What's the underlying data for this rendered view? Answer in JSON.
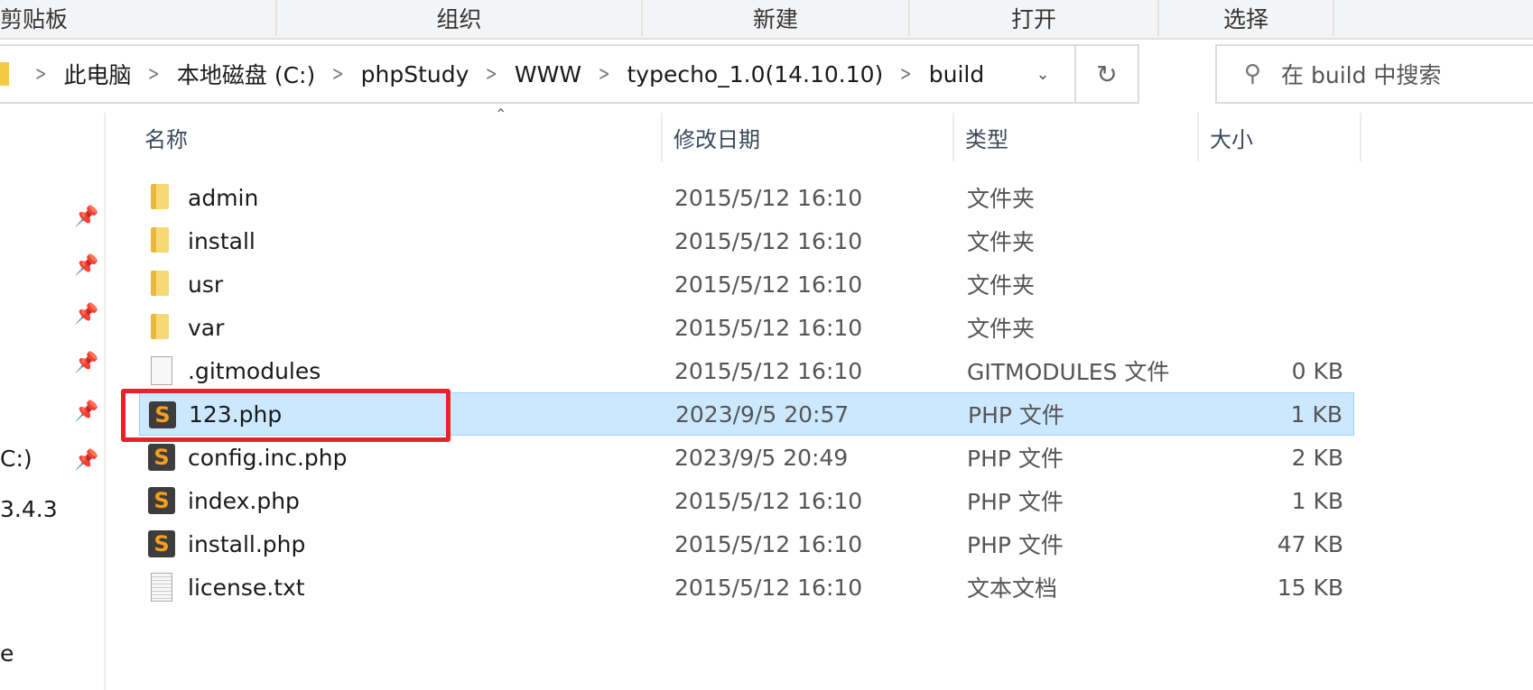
{
  "ribbon": {
    "groups": [
      "剪贴板",
      "组织",
      "新建",
      "打开",
      "选择"
    ]
  },
  "address": {
    "crumbs": [
      "此电脑",
      "本地磁盘 (C:)",
      "phpStudy",
      "WWW",
      "typecho_1.0(14.10.10)",
      "build"
    ]
  },
  "search": {
    "placeholder": "在 build 中搜索"
  },
  "sidebar": {
    "texts": [
      "C:)",
      "3.4.3",
      "e"
    ]
  },
  "columns": {
    "name": "名称",
    "date": "修改日期",
    "type": "类型",
    "size": "大小"
  },
  "highlight_color": "#e8212b",
  "files": [
    {
      "name": "admin",
      "date": "2015/5/12 16:10",
      "type": "文件夹",
      "size": "",
      "icon": "folder"
    },
    {
      "name": "install",
      "date": "2015/5/12 16:10",
      "type": "文件夹",
      "size": "",
      "icon": "folder"
    },
    {
      "name": "usr",
      "date": "2015/5/12 16:10",
      "type": "文件夹",
      "size": "",
      "icon": "folder"
    },
    {
      "name": "var",
      "date": "2015/5/12 16:10",
      "type": "文件夹",
      "size": "",
      "icon": "folder"
    },
    {
      "name": ".gitmodules",
      "date": "2015/5/12 16:10",
      "type": "GITMODULES 文件",
      "size": "0 KB",
      "icon": "file"
    },
    {
      "name": "123.php",
      "date": "2023/9/5 20:57",
      "type": "PHP 文件",
      "size": "1 KB",
      "icon": "php",
      "selected": true
    },
    {
      "name": "config.inc.php",
      "date": "2023/9/5 20:49",
      "type": "PHP 文件",
      "size": "2 KB",
      "icon": "php"
    },
    {
      "name": "index.php",
      "date": "2015/5/12 16:10",
      "type": "PHP 文件",
      "size": "1 KB",
      "icon": "php"
    },
    {
      "name": "install.php",
      "date": "2015/5/12 16:10",
      "type": "PHP 文件",
      "size": "47 KB",
      "icon": "php"
    },
    {
      "name": "license.txt",
      "date": "2015/5/12 16:10",
      "type": "文本文档",
      "size": "15 KB",
      "icon": "txt"
    }
  ]
}
